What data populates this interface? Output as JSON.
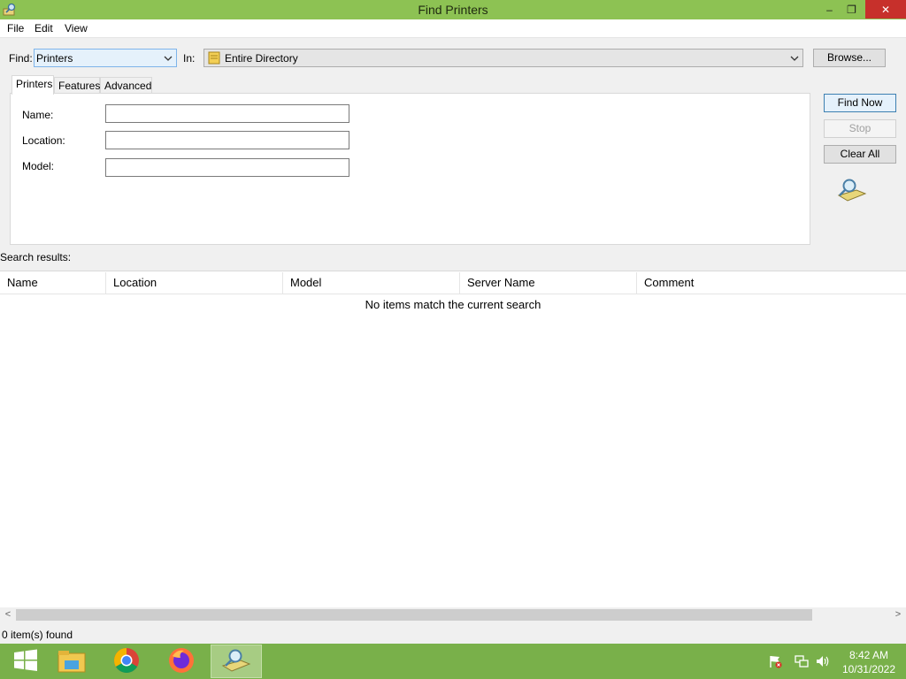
{
  "window": {
    "title": "Find Printers",
    "app_icon": "find-printers-icon",
    "controls": {
      "minimize": "–",
      "maximize": "❐",
      "close": "✕"
    }
  },
  "menu": {
    "items": [
      "File",
      "Edit",
      "View"
    ]
  },
  "find_row": {
    "find_label": "Find:",
    "find_value": "Printers",
    "in_label": "In:",
    "in_value": "Entire Directory",
    "browse_label": "Browse..."
  },
  "tabs": [
    "Printers",
    "Features",
    "Advanced"
  ],
  "form": {
    "name_label": "Name:",
    "location_label": "Location:",
    "model_label": "Model:",
    "name_value": "",
    "location_value": "",
    "model_value": ""
  },
  "buttons": {
    "find_now": "Find Now",
    "stop": "Stop",
    "clear_all": "Clear All"
  },
  "results": {
    "label": "Search results:",
    "columns": [
      "Name",
      "Location",
      "Model",
      "Server Name",
      "Comment"
    ],
    "empty_message": "No items match the current search",
    "scroll_left": "<",
    "scroll_right": ">"
  },
  "status": {
    "text": "0 item(s) found"
  },
  "taskbar": {
    "items": [
      "windows-start-icon",
      "file-explorer-icon",
      "chrome-icon",
      "firefox-icon",
      "find-printers-icon"
    ],
    "time": "8:42 AM",
    "date": "10/31/2022"
  },
  "colors": {
    "accent": "#8dc253",
    "taskbar": "#79b04a",
    "close": "#c7302b"
  }
}
